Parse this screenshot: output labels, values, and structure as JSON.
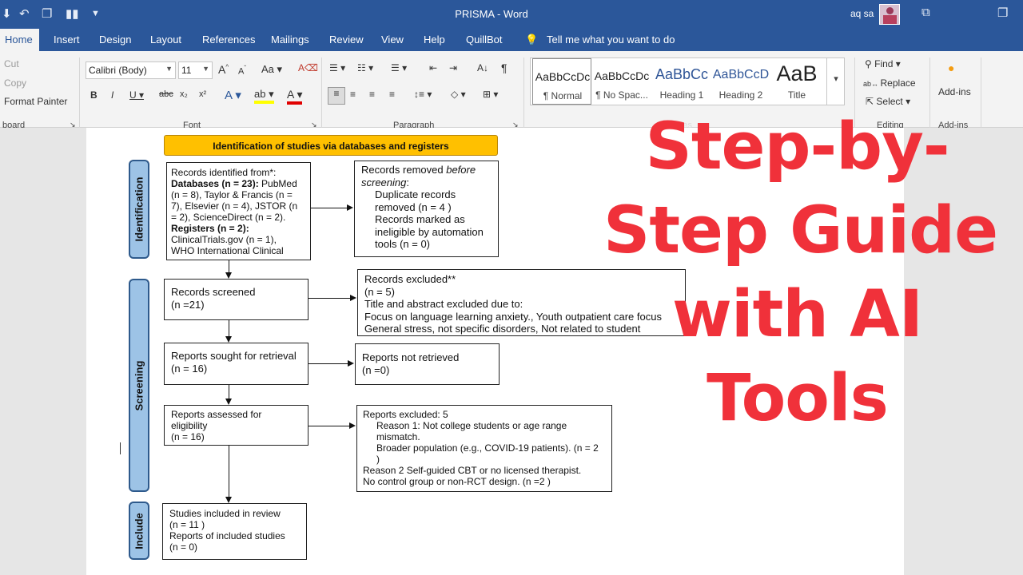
{
  "titlebar": {
    "document_title": "PRISMA - Word",
    "user_name": "aq sa",
    "bg_color": "#2b579a"
  },
  "tabs": [
    {
      "label": "Home",
      "active": true
    },
    {
      "label": "Insert"
    },
    {
      "label": "Design"
    },
    {
      "label": "Layout"
    },
    {
      "label": "References"
    },
    {
      "label": "Mailings"
    },
    {
      "label": "Review"
    },
    {
      "label": "View"
    },
    {
      "label": "Help"
    },
    {
      "label": "QuillBot"
    }
  ],
  "tell_me": "Tell me what you want to do",
  "clipboard": {
    "cut": "Cut",
    "copy": "Copy",
    "format_painter": "Format Painter",
    "group_label": "board"
  },
  "font": {
    "name": "Calibri (Body)",
    "size": "11",
    "group_label": "Font"
  },
  "paragraph": {
    "group_label": "Paragraph"
  },
  "styles": {
    "items": [
      {
        "preview": "AaBbCcDc",
        "name": "¶ Normal"
      },
      {
        "preview": "AaBbCcDc",
        "name": "¶ No Spac..."
      },
      {
        "preview": "AaBbCc",
        "name": "Heading 1"
      },
      {
        "preview": "AaBbCcD",
        "name": "Heading 2"
      },
      {
        "preview": "AaB",
        "name": "Title"
      }
    ],
    "group_label": "Styles"
  },
  "editing": {
    "find": "Find",
    "replace": "Replace",
    "select": "Select",
    "group_label": "Editing"
  },
  "addins": {
    "label": "Add-ins",
    "group_label": "Add-ins"
  },
  "prisma": {
    "banner": "Identification of studies via databases and registers",
    "phases": {
      "identification": "Identification",
      "screening": "Screening",
      "include": "Include"
    },
    "records_identified": {
      "l1": "Records identified from*:",
      "l2b": "Databases (n = 23):",
      "l2": " PubMed",
      "l3": "(n = 8), Taylor & Francis (n =",
      "l4": "7), Elsevier (n = 4), JSTOR (n",
      "l5": "= 2), ScienceDirect (n = 2).",
      "l6b": "Registers (n = 2):",
      "l7": "ClinicalTrials.gov (n = 1),",
      "l8": "WHO International Clinical"
    },
    "records_removed": {
      "l1a": "Records removed ",
      "l1i": "before",
      "l2i": "screening",
      "l2": ":",
      "l3": "Duplicate records",
      "l4": "removed (n = 4 )",
      "l5": "Records marked as",
      "l6": "ineligible by automation",
      "l7": "tools (n = 0)"
    },
    "records_screened": {
      "l1": "Records screened",
      "l2": "(n =21)"
    },
    "records_excluded": {
      "l1": "Records excluded**",
      "l2": "(n = 5)",
      "l3": "Title and abstract excluded due to:",
      "l4": "Focus on language learning anxiety., Youth outpatient care focus",
      "l5": "General stress, not specific disorders, Not related to student"
    },
    "reports_sought": {
      "l1": "Reports sought for retrieval",
      "l2": "(n = 16)"
    },
    "reports_not_retrieved": {
      "l1": "Reports not retrieved",
      "l2": "(n =0)"
    },
    "reports_assessed": {
      "l1": "Reports assessed for",
      "l2": "eligibility",
      "l3": "(n = 16)"
    },
    "reports_excluded": {
      "l1": "Reports excluded: 5",
      "l2": "Reason 1:  Not college students or age range",
      "l3": "mismatch.",
      "l4": "Broader population (e.g., COVID-19 patients). (n = 2",
      "l5": ")",
      "l6": "Reason 2 Self-guided CBT or no licensed therapist.",
      "l7": "No control group or non-RCT design.  (n =2 )"
    },
    "included": {
      "l1": "Studies included in review",
      "l2": "(n = 11 )",
      "l3": "Reports of included studies",
      "l4": "(n = 0)"
    }
  },
  "overlay": {
    "line1": "Step-by-",
    "line2": "Step Guide",
    "line3": "with AI",
    "line4": "Tools",
    "color": "#f0313a"
  }
}
